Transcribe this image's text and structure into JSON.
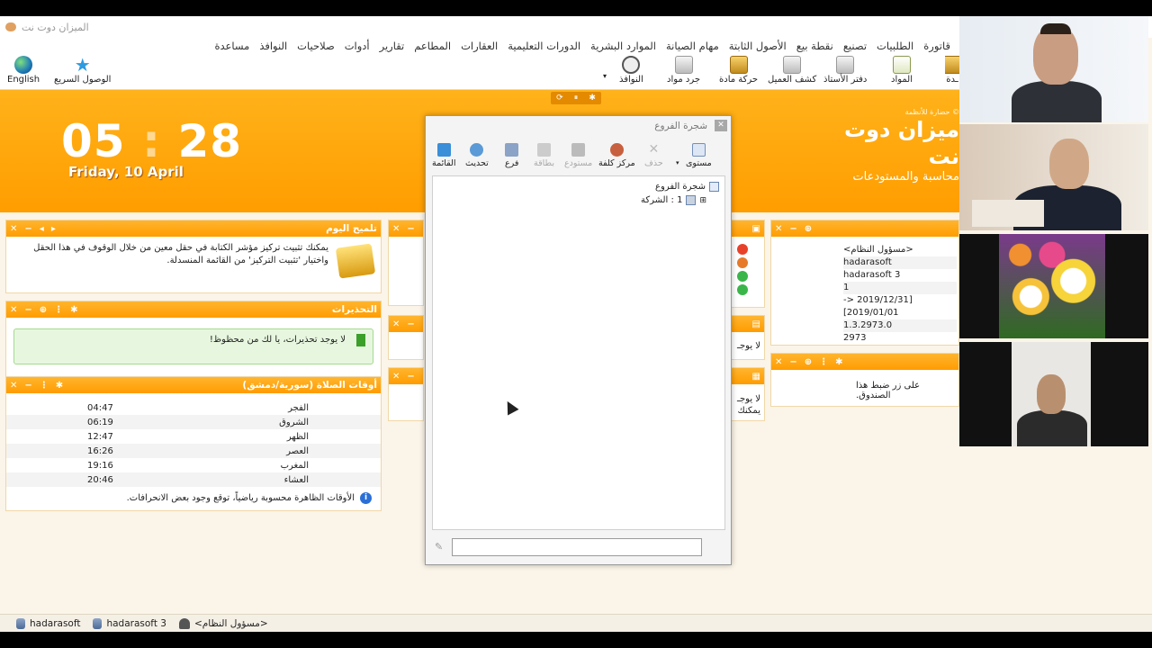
{
  "app": {
    "title": "الميزان دوت نت"
  },
  "menu": [
    "قاتورة",
    "الطلبيات",
    "تصنيع",
    "نقطة بيع",
    "الأصول الثابتة",
    "مهام الصيانة",
    "الموارد البشرية",
    "الدورات التعليمية",
    "العقارات",
    "المطاعم",
    "تقارير",
    "أدوات",
    "صلاحيات",
    "النوافذ",
    "مساعدة"
  ],
  "toolbar": {
    "left": [
      {
        "label": "English",
        "icon": "globe-icon"
      },
      {
        "label": "الوصول السريع",
        "icon": "star-icon"
      }
    ],
    "windows": {
      "label": "النوافذ",
      "icon": "clock-icon"
    },
    "items": [
      {
        "label": "جرد مواد",
        "icon": "printer-icon"
      },
      {
        "label": "حركة مادة",
        "icon": "box-icon"
      },
      {
        "label": "كشف العميل",
        "icon": "printer-icon"
      },
      {
        "label": "دفتر الأستاذ",
        "icon": "printer-icon"
      },
      {
        "label": "المواد",
        "icon": "note-icon"
      },
      {
        "label": "ـدة",
        "icon": "box-icon"
      }
    ]
  },
  "banner": {
    "hours": "05",
    "minutes": "28",
    "date": "Friday, 10 April",
    "brand_copy": "© حضارة للأنظمة",
    "brand_name": "ميزان دوت نت",
    "brand_sub": "محاسبة والمستودعات"
  },
  "tip_panel": {
    "title": "تلميح اليوم",
    "text": "يمكنك تثبيت تركيز مؤشر الكتابة في حقل معين من خلال الوقوف في هذا الحقل واختيار 'تثبيت التركيز' من القائمة المنسدلة."
  },
  "warnings_panel": {
    "title": "التحذيرات",
    "message": "لا يوجد تحذيرات، يا لك من محظوظ!"
  },
  "prayer_panel": {
    "title": "أوقات الصلاة (سورية/دمشق)",
    "times": [
      {
        "name": "الفجر",
        "time": "04:47"
      },
      {
        "name": "الشروق",
        "time": "06:19"
      },
      {
        "name": "الظهر",
        "time": "12:47"
      },
      {
        "name": "العصر",
        "time": "16:26"
      },
      {
        "name": "المغرب",
        "time": "19:16"
      },
      {
        "name": "العشاء",
        "time": "20:46"
      }
    ],
    "note": "الأوقات الظاهرة محسوبة رياضياً، توقع وجود بعض الانحرافات."
  },
  "mid_panels": {
    "p3_line1": "لا يوجـ",
    "p4_line1": "لا يوجـ",
    "p4_line2": "يمكنك"
  },
  "right_panel": {
    "lines": [
      "<مسؤول النظام>",
      "hadarasoft",
      "hadarasoft 3",
      "1",
      "[2019/12/31 <- 2019/01/01]",
      "1.3.2973.0",
      "2973"
    ]
  },
  "cash_panel": {
    "text": "على زر ضبط هذا الصندوق."
  },
  "dialog": {
    "title": "شجرة الفروع",
    "tools": [
      {
        "label": "القائمة",
        "enabled": true
      },
      {
        "label": "تحديث",
        "enabled": true
      },
      {
        "label": "فرع",
        "enabled": true
      },
      {
        "label": "بطاقة",
        "enabled": false
      },
      {
        "label": "مستودع",
        "enabled": false
      },
      {
        "label": "مركز كلفة",
        "enabled": true
      },
      {
        "label": "حذف",
        "enabled": false
      },
      {
        "label": "مستوى",
        "enabled": true
      }
    ],
    "tree_root": "شجرة الفروع",
    "tree_child": "1 : الشركة"
  },
  "status": {
    "item1": "hadarasoft",
    "item2": "hadarasoft 3",
    "item3": "<مسؤول النظام>"
  },
  "colors": {
    "accent": "#ff9d00",
    "panel_head": "#ffb52e",
    "background": "#fbf4e8"
  }
}
